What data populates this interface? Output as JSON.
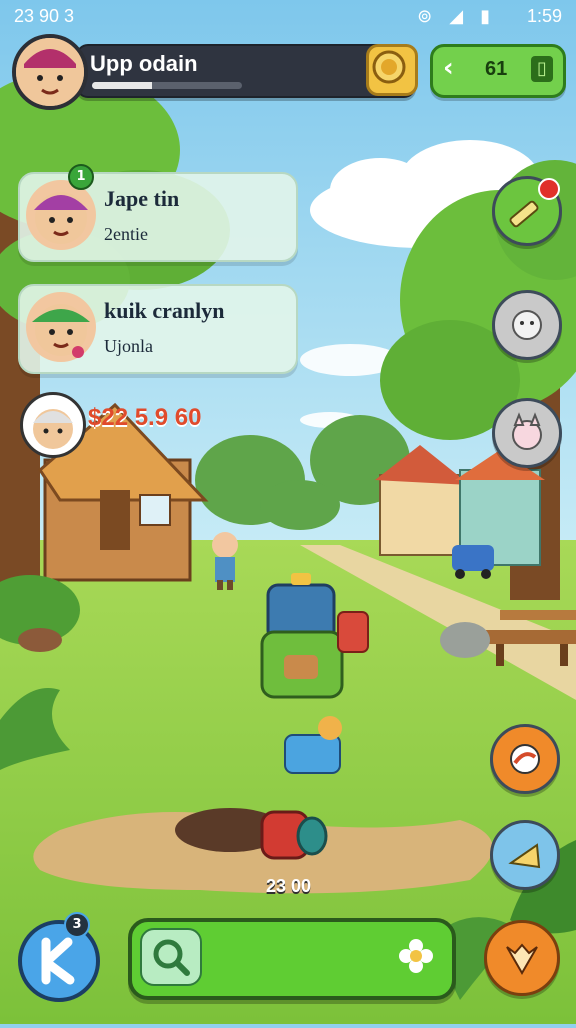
{
  "status": {
    "left": "23 90 3",
    "right": "1:59",
    "icons": [
      "alarm-icon",
      "signal-icon",
      "battery-icon"
    ]
  },
  "player": {
    "name": "Upp odain",
    "xp_fraction": 0.4,
    "energy_label": "61"
  },
  "friends": [
    {
      "name": "Jape tin",
      "sub": "2entie",
      "badge": "1",
      "hat": "#a33fa4"
    },
    {
      "name": "kuik cranlyn",
      "sub": "Ujonla",
      "badge": "",
      "hat": "#3ea64a"
    }
  ],
  "score_text": "$22 5.9 60",
  "ground_amount": "23 00",
  "bottom_badge": "3",
  "colors": {
    "accent_green": "#5fcd33",
    "accent_blue": "#4aa5e8",
    "accent_orange": "#f08a2a",
    "score_red": "#e04b2c"
  }
}
